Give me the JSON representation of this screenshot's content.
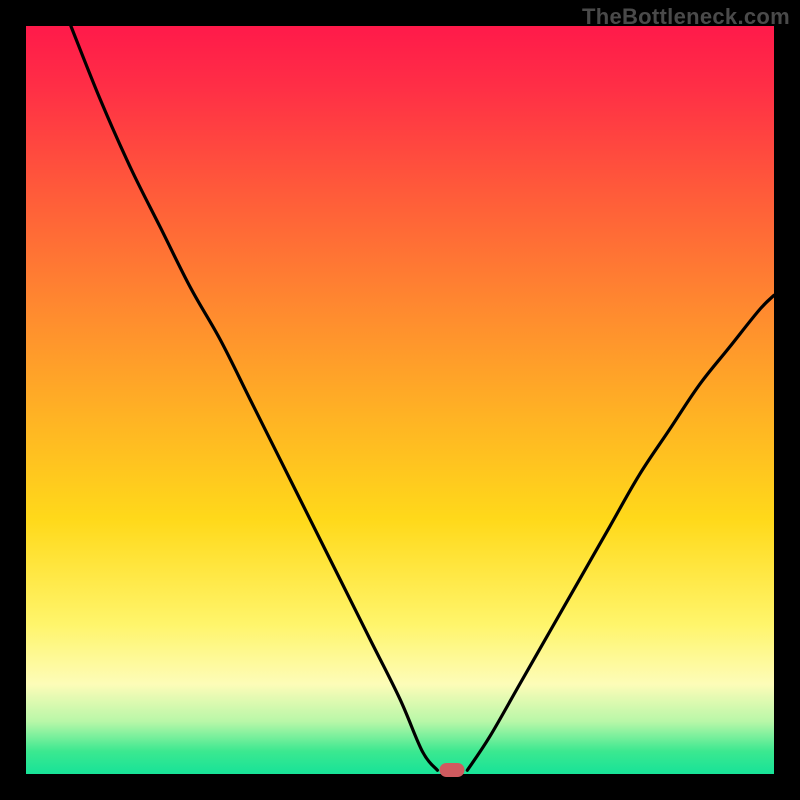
{
  "watermark": "TheBottleneck.com",
  "colors": {
    "frameBackground": "#000000",
    "gradientStops": [
      "#ff1a4a",
      "#ff5a3a",
      "#ff8a2f",
      "#ffb224",
      "#ffd91a",
      "#fff56b",
      "#fdfcb8",
      "#b8f7a8",
      "#3be890",
      "#17e398"
    ],
    "curveStroke": "#000000",
    "markerFill": "#d05a5f"
  },
  "chart_data": {
    "type": "line",
    "title": "",
    "xlabel": "",
    "ylabel": "",
    "xlim": [
      0,
      100
    ],
    "ylim": [
      0,
      100
    ],
    "grid": false,
    "legend": false,
    "series": [
      {
        "name": "left-branch",
        "x": [
          6,
          10,
          14,
          18,
          22,
          26,
          30,
          34,
          38,
          42,
          46,
          50,
          53,
          55
        ],
        "values": [
          100,
          90,
          81,
          73,
          65,
          58,
          50,
          42,
          34,
          26,
          18,
          10,
          3,
          0.5
        ]
      },
      {
        "name": "right-branch",
        "x": [
          59,
          62,
          66,
          70,
          74,
          78,
          82,
          86,
          90,
          94,
          98,
          100
        ],
        "values": [
          0.5,
          5,
          12,
          19,
          26,
          33,
          40,
          46,
          52,
          57,
          62,
          64
        ]
      }
    ],
    "annotations": [
      {
        "name": "minimum-marker",
        "x": 57,
        "y": 0.5
      }
    ]
  }
}
